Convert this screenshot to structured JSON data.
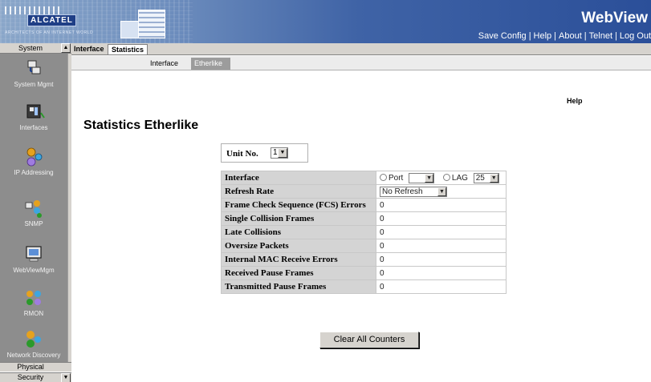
{
  "header": {
    "logo_text": "ALCATEL",
    "logo_tagline": "ARCHITECTS OF AN INTERNET WORLD",
    "app_title": "WebView",
    "links": [
      "Save Config",
      "Help",
      "About",
      "Telnet",
      "Log Out"
    ]
  },
  "sidebar": {
    "top_label": "System",
    "items": [
      {
        "label": "System Mgmt",
        "icon": "system-mgmt-icon"
      },
      {
        "label": "Interfaces",
        "icon": "interfaces-icon"
      },
      {
        "label": "IP Addressing",
        "icon": "ip-addressing-icon"
      },
      {
        "label": "SNMP",
        "icon": "snmp-icon"
      },
      {
        "label": "WebViewMgm",
        "icon": "webview-mgmt-icon"
      },
      {
        "label": "RMON",
        "icon": "rmon-icon"
      },
      {
        "label": "Network Discovery",
        "icon": "network-discovery-icon"
      }
    ],
    "bottom_labels": [
      "Physical",
      "Security"
    ]
  },
  "tabs": {
    "main": [
      "Interface",
      "Statistics"
    ],
    "active_main": "Statistics",
    "sub": [
      "Interface",
      "Etherlike"
    ],
    "active_sub": "Etherlike"
  },
  "content": {
    "help_label": "Help",
    "page_title": "Statistics Etherlike",
    "unit_label": "Unit No.",
    "unit_value": "1",
    "rows": [
      {
        "name": "Interface",
        "value": ""
      },
      {
        "name": "Refresh Rate",
        "value": "No Refresh"
      },
      {
        "name": "Frame Check Sequence (FCS) Errors",
        "value": "0"
      },
      {
        "name": "Single Collision Frames",
        "value": "0"
      },
      {
        "name": "Late Collisions",
        "value": "0"
      },
      {
        "name": "Oversize Packets",
        "value": "0"
      },
      {
        "name": "Internal MAC Receive Errors",
        "value": "0"
      },
      {
        "name": "Received Pause Frames",
        "value": "0"
      },
      {
        "name": "Transmitted Pause Frames",
        "value": "0"
      }
    ],
    "interface_port_label": "Port",
    "interface_port_value": "",
    "interface_lag_label": "LAG",
    "interface_lag_value": "25",
    "clear_button": "Clear All Counters"
  },
  "colors": {
    "banner_dark": "#2b4f99",
    "banner_light": "#8aa6c9",
    "sidebar_bg": "#8d8d8d",
    "table_label_bg": "#d4d4d4",
    "button_face": "#d6d3ce"
  }
}
